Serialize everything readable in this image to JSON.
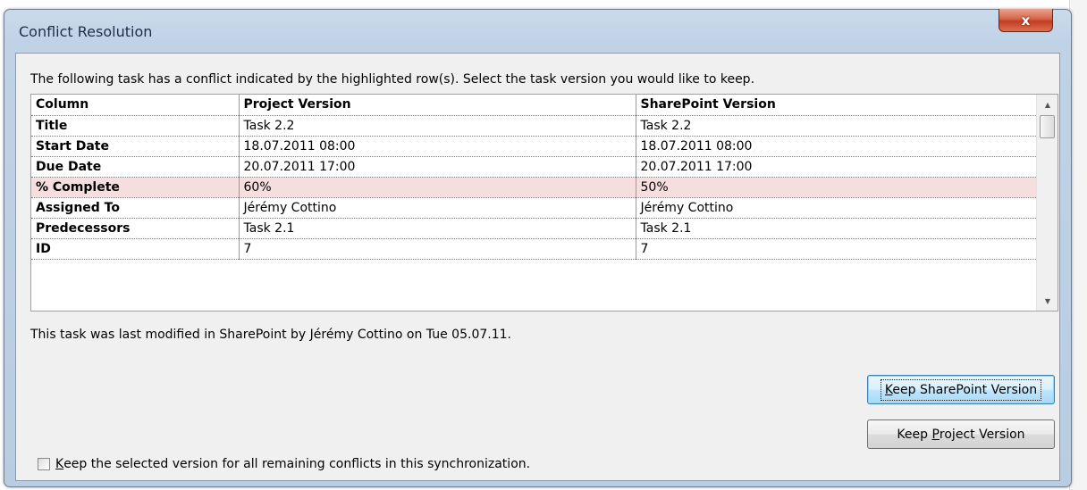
{
  "window": {
    "title": "Conflict Resolution",
    "close_glyph": "x"
  },
  "instruction": "The following task has a conflict indicated by the highlighted row(s). Select the task version you would like to keep.",
  "grid": {
    "headers": [
      "Column",
      "Project Version",
      "SharePoint Version"
    ],
    "rows": [
      {
        "column": "Title",
        "project": "Task 2.2",
        "sharepoint": "Task 2.2",
        "conflict": false
      },
      {
        "column": "Start Date",
        "project": "18.07.2011 08:00",
        "sharepoint": "18.07.2011 08:00",
        "conflict": false
      },
      {
        "column": "Due Date",
        "project": "20.07.2011 17:00",
        "sharepoint": "20.07.2011 17:00",
        "conflict": false
      },
      {
        "column": "% Complete",
        "project": "60%",
        "sharepoint": "50%",
        "conflict": true
      },
      {
        "column": "Assigned To",
        "project": "Jérémy Cottino",
        "sharepoint": "Jérémy Cottino",
        "conflict": false
      },
      {
        "column": "Predecessors",
        "project": "Task 2.1",
        "sharepoint": "Task 2.1",
        "conflict": false
      },
      {
        "column": "ID",
        "project": "7",
        "sharepoint": "7",
        "conflict": false
      }
    ],
    "highlight_color": "#f6dede"
  },
  "modified_text": "This task was last modified in SharePoint by Jérémy Cottino on Tue 05.07.11.",
  "buttons": {
    "keep_sharepoint": {
      "mnemonic": "K",
      "rest": "eep SharePoint Version"
    },
    "keep_project": {
      "before": "Keep ",
      "mnemonic": "P",
      "rest": "roject Version"
    }
  },
  "checkbox": {
    "checked": false,
    "mnemonic": "K",
    "rest": "eep the selected version for all remaining conflicts in this synchronization."
  },
  "colors": {
    "close_button": "#c23d22",
    "default_button_border": "#3c7fb1"
  }
}
